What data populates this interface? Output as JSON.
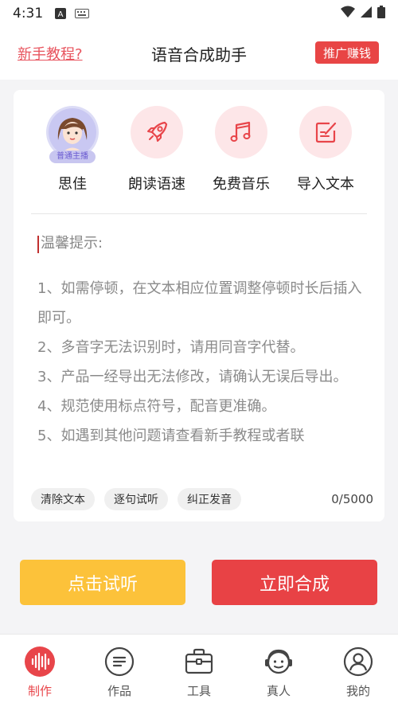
{
  "status": {
    "time": "4:31"
  },
  "header": {
    "tutorial": "新手教程?",
    "title": "语音合成助手",
    "promo": "推广赚钱"
  },
  "tools": [
    {
      "label": "思佳",
      "badge": "普通主播",
      "icon": "avatar"
    },
    {
      "label": "朗读语速",
      "icon": "rocket-icon"
    },
    {
      "label": "免费音乐",
      "icon": "music-note-icon"
    },
    {
      "label": "导入文本",
      "icon": "edit-icon"
    }
  ],
  "editor": {
    "tips_title": "温馨提示:",
    "tips": [
      "1、如需停顿，在文本相应位置调整停顿时长后插入即可。",
      "2、多音字无法识别时，请用同音字代替。",
      "3、产品一经导出无法修改，请确认无误后导出。",
      "4、规范使用标点符号，配音更准确。",
      "5、如遇到其他问题请查看新手教程或者联"
    ],
    "char_count": "0/5000"
  },
  "chips": {
    "clear": "清除文本",
    "sentence": "逐句试听",
    "correct": "纠正发音"
  },
  "buttons": {
    "listen": "点击试听",
    "synth": "立即合成"
  },
  "tabs": [
    {
      "label": "制作",
      "icon": "waveform-icon",
      "active": true
    },
    {
      "label": "作品",
      "icon": "list-icon"
    },
    {
      "label": "工具",
      "icon": "briefcase-icon"
    },
    {
      "label": "真人",
      "icon": "headset-icon"
    },
    {
      "label": "我的",
      "icon": "user-icon"
    }
  ],
  "colors": {
    "accent": "#e84245",
    "yellow": "#fcc23a",
    "pink_bg": "#fde6e8"
  }
}
